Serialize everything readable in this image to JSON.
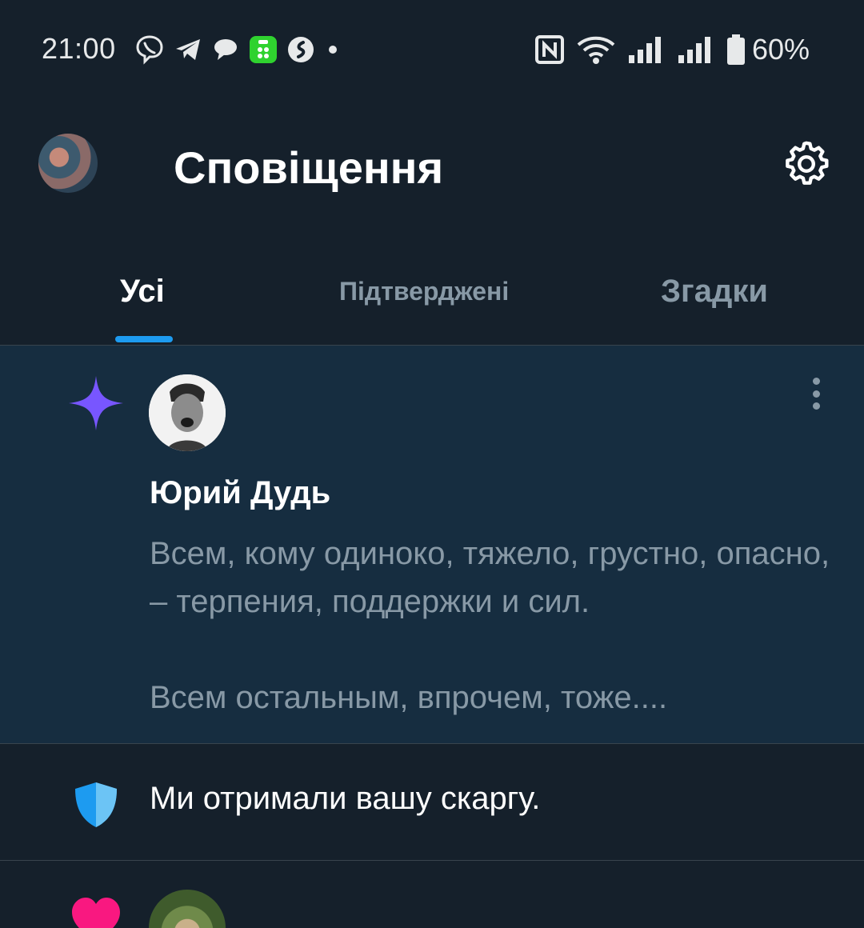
{
  "status_bar": {
    "time": "21:00",
    "left_icons": [
      "viber-icon",
      "telegram-icon",
      "chat-bubble-icon",
      "green-app-icon",
      "shazam-icon",
      "dot-icon"
    ],
    "right_icons": [
      "nfc-icon",
      "wifi-icon",
      "signal-icon",
      "signal-icon",
      "battery-icon"
    ],
    "battery": "60%"
  },
  "header": {
    "title": "Сповіщення",
    "settings_icon": "gear-icon"
  },
  "tabs": [
    {
      "label": "Усі",
      "active": true
    },
    {
      "label": "Підтверджені",
      "active": false
    },
    {
      "label": "Згадки",
      "active": false
    }
  ],
  "notifications": [
    {
      "icon": "sparkle-icon",
      "icon_color": "#7856ff",
      "author": "Юрий Дудь",
      "text": "Всем, кому одиноко, тяжело, грустно, опасно, – терпения, поддержки и сил.\n\nВсем остальным, впрочем, тоже...."
    },
    {
      "icon": "shield-icon",
      "icon_color": "#1d9bf0",
      "text": "Ми отримали вашу скаргу."
    },
    {
      "icon": "heart-icon",
      "icon_color": "#f91880"
    }
  ],
  "colors": {
    "background": "#15202b",
    "highlight_background": "#162d40",
    "accent": "#1d9bf0",
    "secondary_text": "#8899a6",
    "divider": "#38444d"
  }
}
